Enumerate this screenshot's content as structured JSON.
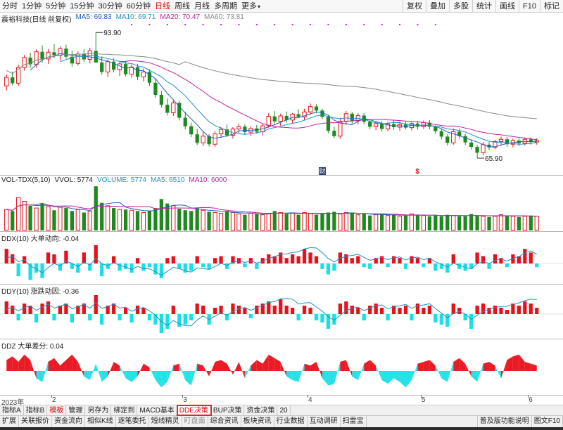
{
  "toolbar": {
    "periods": [
      {
        "label": "分时",
        "active": false
      },
      {
        "label": "1分钟",
        "active": false
      },
      {
        "label": "5分钟",
        "active": false
      },
      {
        "label": "15分钟",
        "active": false
      },
      {
        "label": "30分钟",
        "active": false
      },
      {
        "label": "60分钟",
        "active": false
      },
      {
        "label": "日线",
        "active": true
      },
      {
        "label": "周线",
        "active": false
      },
      {
        "label": "月线",
        "active": false
      },
      {
        "label": "多周期",
        "active": false
      },
      {
        "label": "更多",
        "active": false
      }
    ],
    "tools": [
      "复权",
      "叠加",
      "多股",
      "统计",
      "画线",
      "F10",
      "标记"
    ]
  },
  "main_pane": {
    "stock_title": "震裕科技(日线 前复权)",
    "ma5": "MA5: 69.83",
    "ma10": "MA10: 69.71",
    "ma20": "MA20: 70.47",
    "ma60": "MA60: 73.81",
    "high_label": "93.90",
    "low_label": "65.90",
    "event_marks": [
      "财",
      "$"
    ]
  },
  "vol_pane": {
    "title": "VOL-TDX(5,10)",
    "vvol": "VVOL: 5774",
    "volume": "VOLUME: 5774",
    "ma5": "MA5: 6510",
    "ma10": "MA10: 6000"
  },
  "ddx_pane": {
    "title": "DDX(10) 大单动向: -0.04"
  },
  "ddy_pane": {
    "title": "DDY(10) 涨跌动因: -0.36"
  },
  "ddz_pane": {
    "title": "DDZ 大单差分: 0.04"
  },
  "date_axis": [
    "2023年",
    "2",
    "3",
    "4",
    "5",
    "6"
  ],
  "tabs_row1": [
    {
      "label": "指标A",
      "style": ""
    },
    {
      "label": "指标B",
      "style": ""
    },
    {
      "label": "模板",
      "style": "red"
    },
    {
      "label": "管理",
      "style": ""
    },
    {
      "label": "另存为",
      "style": ""
    },
    {
      "label": "绑定到",
      "style": ""
    },
    {
      "label": "MACD基本",
      "style": ""
    },
    {
      "label": "DDE决策",
      "style": "highlight"
    },
    {
      "label": "BUP决策",
      "style": ""
    },
    {
      "label": "资金决策",
      "style": ""
    },
    {
      "label": "20",
      "style": ""
    }
  ],
  "tabs_row2": [
    "扩展",
    "关联报价",
    "资金流向",
    "相似K线",
    "逐笔委托",
    "短线精灵",
    "盯盘面",
    "综合资讯",
    "板块资讯",
    "行业数据",
    "互动调研",
    "扫雷宝"
  ],
  "tabs_row2_right": [
    "普及版功能说明",
    "图文F10"
  ],
  "colors": {
    "up": "#e8101a",
    "down": "#1e8a1e",
    "ddx_neg": "#19e0e6",
    "ma5_line": "#2060c0",
    "ma10_line": "#1e90c8",
    "ma20_line": "#c020a0",
    "ma60_line": "#888888",
    "highlight": "#d03030"
  },
  "chart_data": {
    "type": "candlestick",
    "title": "震裕科技(日线 前复权)",
    "y_marks": {
      "high": 93.9,
      "low": 65.9
    },
    "candles_ohlc": [
      [
        82.0,
        84.6,
        81.0,
        83.9
      ],
      [
        83.9,
        85.2,
        82.1,
        82.6
      ],
      [
        82.6,
        86.7,
        82.0,
        86.1
      ],
      [
        86.1,
        88.9,
        85.4,
        88.3
      ],
      [
        88.3,
        89.4,
        86.0,
        86.8
      ],
      [
        86.8,
        90.1,
        86.0,
        89.6
      ],
      [
        89.6,
        91.0,
        87.2,
        88.0
      ],
      [
        88.0,
        90.2,
        86.9,
        89.5
      ],
      [
        89.5,
        91.3,
        88.2,
        88.8
      ],
      [
        88.8,
        90.8,
        87.6,
        90.3
      ],
      [
        90.3,
        91.2,
        88.0,
        88.5
      ],
      [
        88.5,
        89.8,
        86.3,
        87.0
      ],
      [
        87.0,
        89.7,
        86.5,
        89.1
      ],
      [
        89.1,
        90.2,
        87.3,
        87.9
      ],
      [
        87.9,
        90.5,
        87.0,
        89.8
      ],
      [
        89.8,
        93.9,
        88.6,
        87.2
      ],
      [
        87.2,
        88.6,
        84.5,
        85.1
      ],
      [
        85.1,
        87.9,
        84.0,
        87.4
      ],
      [
        87.4,
        88.2,
        85.0,
        85.6
      ],
      [
        85.6,
        87.4,
        84.2,
        86.9
      ],
      [
        86.9,
        87.6,
        84.1,
        84.6
      ],
      [
        84.6,
        86.8,
        83.8,
        86.2
      ],
      [
        86.2,
        86.9,
        83.3,
        84.0
      ],
      [
        84.0,
        85.9,
        83.0,
        85.1
      ],
      [
        85.1,
        85.7,
        82.0,
        82.7
      ],
      [
        82.7,
        83.6,
        79.4,
        80.0
      ],
      [
        80.0,
        80.9,
        77.2,
        77.8
      ],
      [
        77.8,
        79.2,
        75.4,
        76.0
      ],
      [
        76.0,
        78.8,
        75.3,
        78.2
      ],
      [
        78.2,
        78.6,
        74.3,
        74.9
      ],
      [
        74.9,
        76.2,
        72.3,
        73.0
      ],
      [
        73.0,
        73.8,
        70.6,
        71.2
      ],
      [
        71.2,
        72.4,
        68.8,
        69.3
      ],
      [
        69.3,
        71.7,
        68.6,
        70.8
      ],
      [
        70.8,
        71.3,
        68.5,
        69.0
      ],
      [
        69.0,
        71.9,
        68.4,
        71.3
      ],
      [
        71.3,
        72.9,
        70.5,
        72.3
      ],
      [
        72.3,
        73.4,
        70.6,
        71.0
      ],
      [
        71.0,
        72.8,
        70.2,
        72.4
      ],
      [
        72.4,
        73.6,
        71.5,
        72.9
      ],
      [
        72.9,
        73.4,
        71.1,
        71.7
      ],
      [
        71.7,
        73.0,
        70.8,
        72.5
      ],
      [
        72.5,
        73.3,
        71.3,
        71.8
      ],
      [
        71.8,
        73.5,
        71.0,
        73.1
      ],
      [
        73.1,
        75.9,
        72.7,
        75.2
      ],
      [
        75.2,
        76.4,
        73.5,
        74.1
      ],
      [
        74.1,
        75.8,
        73.1,
        75.3
      ],
      [
        75.3,
        76.3,
        73.8,
        74.4
      ],
      [
        74.4,
        76.0,
        73.6,
        75.7
      ],
      [
        75.7,
        76.8,
        74.8,
        75.1
      ],
      [
        75.1,
        76.9,
        74.3,
        76.2
      ],
      [
        76.2,
        78.1,
        75.5,
        77.4
      ],
      [
        77.4,
        77.9,
        75.9,
        76.5
      ],
      [
        76.5,
        76.9,
        74.6,
        75.1
      ],
      [
        75.1,
        75.6,
        71.4,
        72.0
      ],
      [
        72.0,
        72.9,
        70.4,
        70.8
      ],
      [
        70.8,
        74.9,
        70.2,
        74.1
      ],
      [
        74.1,
        76.4,
        73.3,
        75.8
      ],
      [
        75.8,
        76.2,
        73.6,
        74.2
      ],
      [
        74.2,
        75.9,
        73.4,
        75.4
      ],
      [
        75.4,
        75.9,
        73.4,
        74.0
      ],
      [
        74.0,
        74.5,
        72.3,
        72.9
      ],
      [
        72.9,
        74.2,
        72.1,
        73.6
      ],
      [
        73.6,
        74.1,
        71.8,
        72.4
      ],
      [
        72.4,
        74.0,
        71.9,
        73.5
      ],
      [
        73.5,
        74.3,
        72.2,
        72.8
      ],
      [
        72.8,
        74.1,
        72.0,
        73.4
      ],
      [
        73.4,
        74.0,
        72.3,
        72.7
      ],
      [
        72.7,
        74.0,
        72.1,
        73.6
      ],
      [
        73.6,
        74.2,
        72.3,
        72.9
      ],
      [
        72.9,
        74.3,
        72.4,
        73.8
      ],
      [
        73.8,
        74.4,
        72.3,
        72.9
      ],
      [
        72.9,
        73.2,
        71.3,
        71.9
      ],
      [
        71.9,
        72.4,
        70.1,
        70.7
      ],
      [
        70.7,
        71.2,
        68.7,
        69.3
      ],
      [
        69.3,
        72.5,
        68.9,
        71.8
      ],
      [
        71.8,
        72.5,
        70.2,
        70.8
      ],
      [
        70.8,
        71.3,
        68.8,
        69.4
      ],
      [
        69.4,
        70.1,
        67.8,
        68.4
      ],
      [
        68.4,
        68.9,
        65.9,
        67.1
      ],
      [
        67.1,
        69.5,
        66.5,
        68.9
      ],
      [
        68.9,
        69.5,
        67.7,
        68.3
      ],
      [
        68.3,
        70.0,
        67.9,
        69.6
      ],
      [
        69.6,
        70.7,
        68.9,
        70.1
      ],
      [
        70.1,
        70.6,
        68.4,
        69.0
      ],
      [
        69.0,
        70.3,
        68.3,
        69.8
      ],
      [
        69.8,
        70.3,
        68.6,
        69.2
      ],
      [
        69.2,
        70.5,
        68.7,
        70.1
      ],
      [
        70.1,
        70.6,
        68.9,
        69.5
      ],
      [
        69.5,
        70.3,
        68.9,
        69.8
      ]
    ],
    "volume": [
      28,
      26,
      44,
      39,
      33,
      30,
      36,
      32,
      27,
      31,
      30,
      26,
      28,
      24,
      26,
      59,
      37,
      33,
      30,
      28,
      28,
      27,
      26,
      24,
      26,
      30,
      42,
      36,
      33,
      29,
      27,
      26,
      30,
      27,
      25,
      24,
      23,
      26,
      24,
      22,
      21,
      23,
      22,
      21,
      23,
      26,
      24,
      22,
      23,
      21,
      24,
      23,
      21,
      22,
      24,
      25,
      22,
      24,
      23,
      21,
      22,
      20,
      21,
      22,
      20,
      21,
      19,
      20,
      22,
      21,
      20,
      19,
      20,
      19,
      21,
      20,
      19,
      19,
      22,
      20,
      19,
      18,
      19,
      21,
      20,
      19,
      18,
      19,
      20,
      19
    ],
    "ddx": [
      0.8,
      0.5,
      -0.7,
      0.4,
      -0.9,
      -0.5,
      -0.8,
      0.6,
      0.5,
      -0.4,
      0.7,
      -0.3,
      -0.5,
      0.6,
      -0.4,
      1.0,
      -0.7,
      -0.3,
      0.4,
      -0.4,
      -0.3,
      -0.5,
      0.3,
      -0.4,
      -0.2,
      -0.6,
      -0.8,
      0.3,
      0.4,
      -0.3,
      -0.5,
      -0.4,
      0.4,
      -0.2,
      -0.3,
      0.3,
      0.4,
      -0.3,
      0.4,
      0.3,
      -0.2,
      0.3,
      -0.3,
      0.3,
      0.5,
      0.4,
      0.6,
      0.3,
      0.5,
      0.4,
      0.8,
      0.6,
      0.4,
      -0.3,
      -0.6,
      -0.4,
      0.6,
      0.5,
      0.3,
      0.4,
      -0.2,
      -0.3,
      0.3,
      0.4,
      -0.2,
      0.4,
      0.3,
      -0.3,
      0.4,
      0.3,
      -0.2,
      0.3,
      -0.4,
      -0.3,
      -0.5,
      0.5,
      -0.3,
      -0.4,
      -0.3,
      0.6,
      0.4,
      -0.3,
      0.5,
      0.3,
      -0.2,
      0.5,
      0.4,
      0.8,
      0.6,
      -0.2
    ],
    "ddy": [
      0.6,
      0.4,
      -0.3,
      0.5,
      0.4,
      -0.4,
      0.5,
      0.6,
      -0.3,
      0.4,
      0.5,
      -0.4,
      0.4,
      0.5,
      -0.3,
      0.9,
      -0.5,
      0.4,
      0.5,
      -0.3,
      0.3,
      -0.4,
      0.4,
      0.3,
      -0.3,
      -0.5,
      -0.9,
      -0.7,
      0.4,
      -0.6,
      -0.5,
      -0.3,
      0.5,
      0.4,
      -0.5,
      0.3,
      0.4,
      -0.3,
      0.5,
      0.4,
      0.3,
      -0.2,
      0.4,
      0.5,
      0.6,
      0.4,
      0.7,
      0.4,
      0.3,
      -0.3,
      0.4,
      0.3,
      -0.3,
      -0.4,
      -0.7,
      -0.5,
      0.5,
      0.6,
      0.4,
      0.3,
      -0.3,
      0.4,
      0.5,
      0.3,
      -0.3,
      0.4,
      0.3,
      0.4,
      -0.3,
      0.5,
      0.3,
      0.4,
      -0.4,
      -0.5,
      -0.6,
      0.5,
      0.3,
      -0.3,
      -0.7,
      0.4,
      0.5,
      0.3,
      0.4,
      0.3,
      0.2,
      0.5,
      0.4,
      0.6,
      0.5,
      0.3
    ],
    "ddz": [
      0.6,
      0.8,
      0.5,
      0.9,
      0.6,
      -0.4,
      -0.6,
      0.5,
      0.7,
      0.3,
      0.6,
      0.9,
      0.5,
      -0.3,
      -0.5,
      0.4,
      -0.6,
      -0.3,
      0.5,
      0.3,
      -0.4,
      -0.6,
      -0.3,
      0.4,
      0.2,
      -0.5,
      -0.9,
      -0.6,
      0.3,
      0.4,
      -0.5,
      -0.8,
      0.4,
      0.3,
      -0.3,
      0.5,
      0.6,
      0.4,
      -0.2,
      0.5,
      -0.4,
      0.3,
      0.6,
      0.4,
      0.9,
      0.7,
      0.5,
      -0.3,
      -0.5,
      -0.6,
      0.4,
      0.3,
      0.5,
      -0.4,
      -0.8,
      -0.7,
      0.5,
      0.6,
      -0.3,
      -0.5,
      0.4,
      0.6,
      0.3,
      -0.5,
      -0.7,
      -0.4,
      -0.6,
      -0.9,
      -0.5,
      0.4,
      0.5,
      0.6,
      0.3,
      -0.4,
      -0.6,
      0.5,
      0.7,
      0.4,
      -0.3,
      -0.6,
      0.4,
      0.5,
      0.3,
      -0.4,
      0.6,
      0.8,
      0.9,
      0.5,
      0.4,
      0.3
    ]
  }
}
